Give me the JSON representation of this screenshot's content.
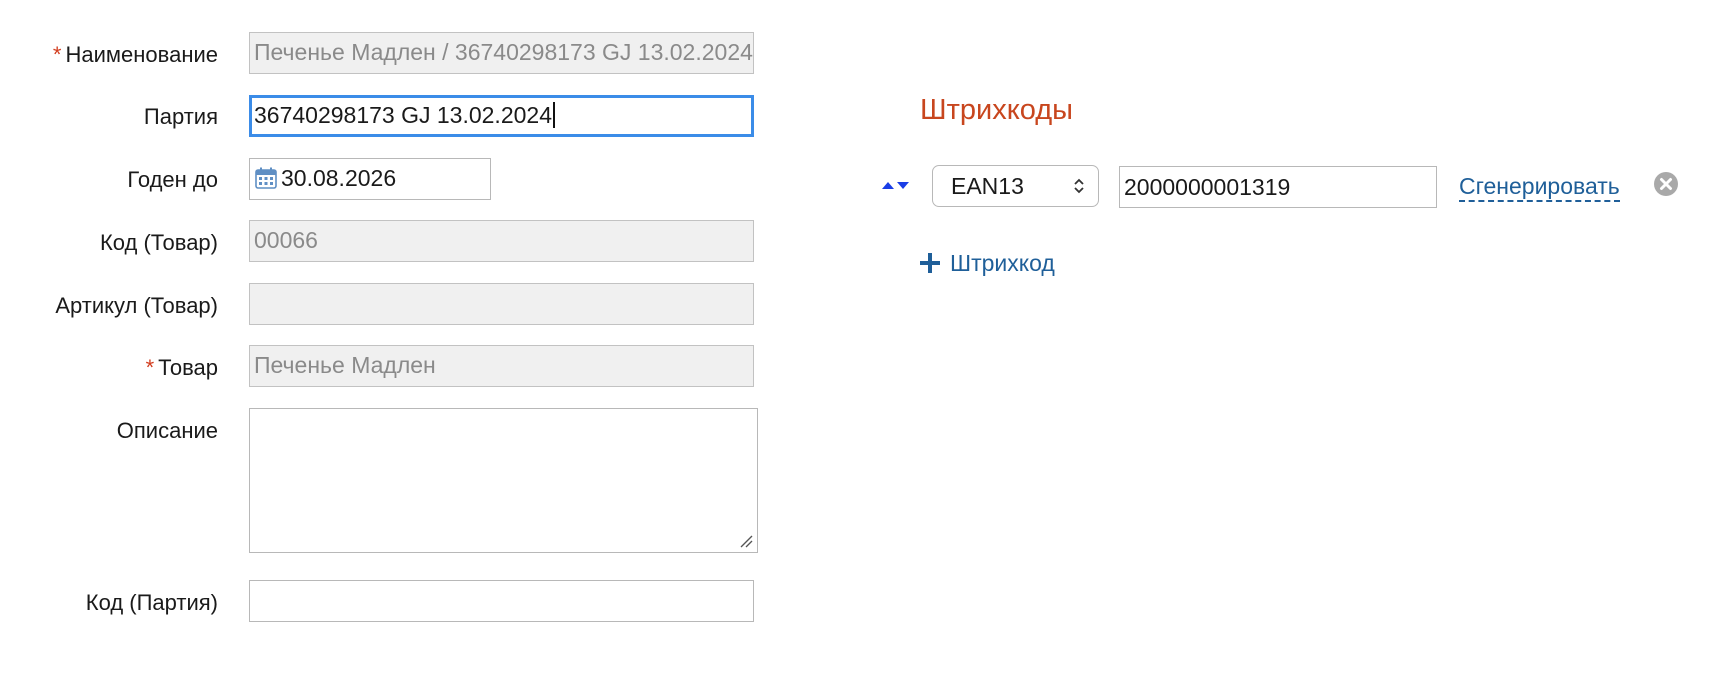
{
  "form": {
    "name": {
      "label": "Наименование",
      "required": true,
      "value": "Печенье Мадлен / 36740298173 GJ 13.02.2024"
    },
    "batch": {
      "label": "Партия",
      "value": "36740298173 GJ 13.02.2024"
    },
    "expiry": {
      "label": "Годен до",
      "value": "30.08.2026",
      "icon": "calendar-icon"
    },
    "product_code": {
      "label": "Код (Товар)",
      "value": "00066"
    },
    "product_article": {
      "label": "Артикул (Товар)",
      "value": ""
    },
    "product": {
      "label": "Товар",
      "required": true,
      "value": "Печенье Мадлен"
    },
    "description": {
      "label": "Описание",
      "value": ""
    },
    "batch_code": {
      "label": "Код (Партия)",
      "value": ""
    }
  },
  "barcodes": {
    "title": "Штрихкоды",
    "items": [
      {
        "type": "EAN13",
        "value": "2000000001319"
      }
    ],
    "generate_label": "Сгенерировать",
    "add_label": "Штрихкод"
  },
  "colors": {
    "required_star": "#d23c1e",
    "section_title": "#c8461e",
    "link": "#1f5f99",
    "focus_border": "#3b8ce8",
    "readonly_bg": "#f0f0f0",
    "sort_arrows": "#1a3ee6"
  },
  "required_mark": "*"
}
